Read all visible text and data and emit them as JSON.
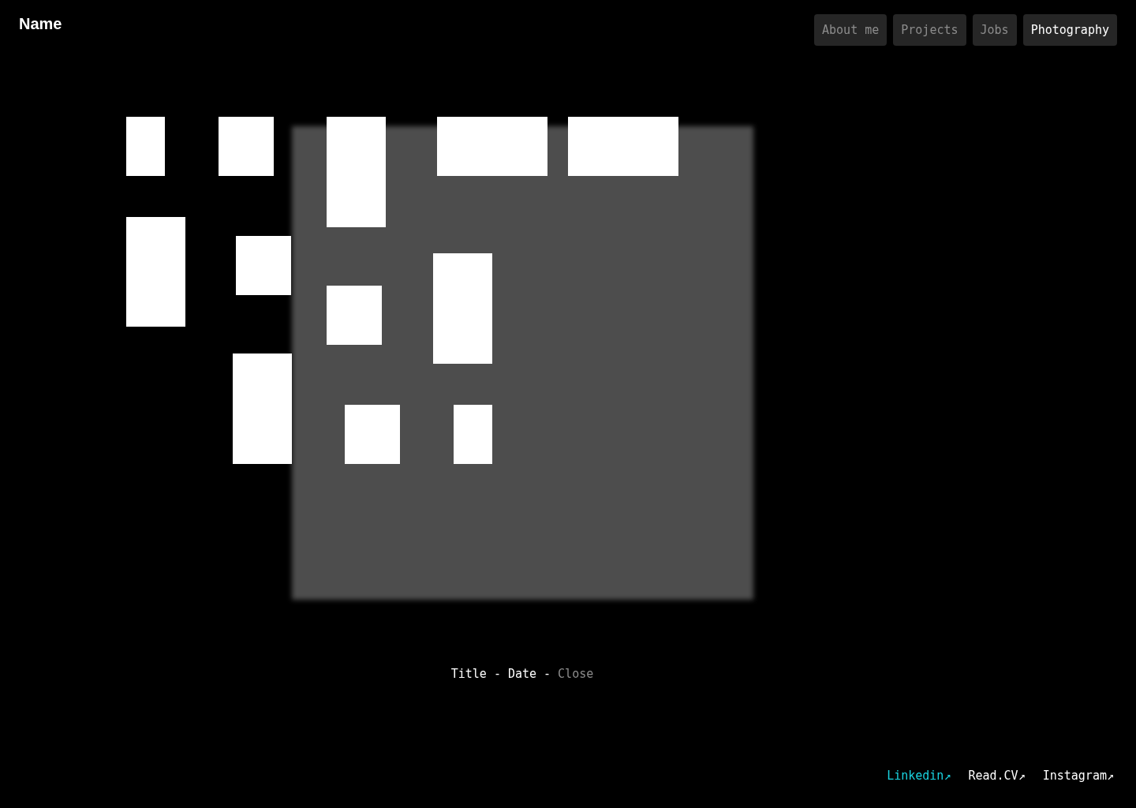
{
  "header": {
    "name": "Name"
  },
  "nav": [
    {
      "label": "About me",
      "selected": false
    },
    {
      "label": "Projects",
      "selected": false
    },
    {
      "label": "Jobs",
      "selected": false
    },
    {
      "label": "Photography",
      "selected": true
    }
  ],
  "lightbox": {
    "title": "Title",
    "separator_1": "-",
    "date": "Date",
    "separator_2": "-",
    "close": "Close"
  },
  "footer_links": [
    {
      "label": "Linkedin↗",
      "highlighted": true
    },
    {
      "label": "Read.CV↗",
      "highlighted": false
    },
    {
      "label": "Instagram↗",
      "highlighted": false
    }
  ]
}
